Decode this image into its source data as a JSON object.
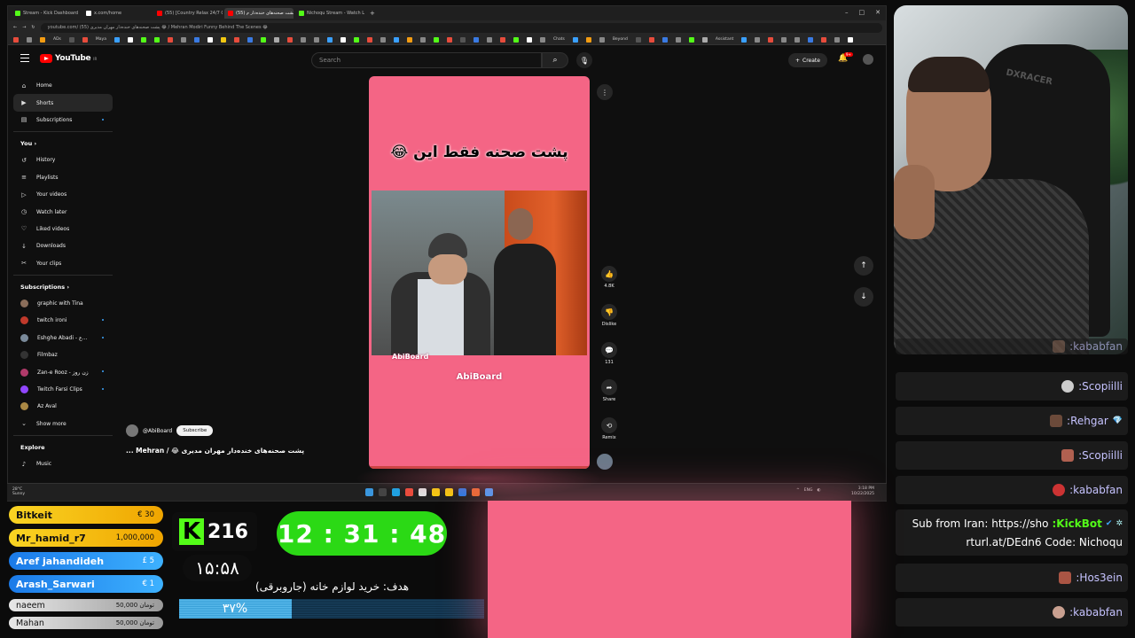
{
  "browser": {
    "tabs": [
      {
        "label": "Stream - Kick Dashboard",
        "color": "#53fc18"
      },
      {
        "label": "x.com/home",
        "color": "#ffffff"
      },
      {
        "label": "(55) [Country Relax 24/7 Co",
        "color": "#ff0000"
      },
      {
        "label": "(55) پشت صحنه‌های خنده‌دار م",
        "color": "#ff0000",
        "active": true
      },
      {
        "label": "Nichoqu Stream - Watch Live",
        "color": "#53fc18"
      }
    ],
    "url": "youtube.com/ (55) پشت صحنه‌های خنده‌دار مهران مدیری 😂 / Mehran Modiri Funny Behind The Scenes 😂",
    "new_tab": "+",
    "window_controls": [
      "–",
      "□",
      "✕"
    ],
    "bookmark_labels": [
      "ADs",
      "Maya",
      "Chats",
      "Beyond",
      "Assistant"
    ]
  },
  "youtube": {
    "logo_text": "YouTube",
    "logo_sup": "IR",
    "search_placeholder": "Search",
    "create_label": "Create",
    "notif_count": "9+",
    "sidebar": {
      "main": [
        {
          "label": "Home",
          "icon": "home-icon",
          "glyph": "⌂"
        },
        {
          "label": "Shorts",
          "icon": "shorts-icon",
          "glyph": "▶",
          "active": true
        },
        {
          "label": "Subscriptions",
          "icon": "subscriptions-icon",
          "glyph": "▤",
          "dot": true
        }
      ],
      "you_header": "You ›",
      "you": [
        {
          "label": "History",
          "icon": "history-icon",
          "glyph": "↺"
        },
        {
          "label": "Playlists",
          "icon": "playlists-icon",
          "glyph": "≡"
        },
        {
          "label": "Your videos",
          "icon": "your-videos-icon",
          "glyph": "▷"
        },
        {
          "label": "Watch later",
          "icon": "watch-later-icon",
          "glyph": "◷"
        },
        {
          "label": "Liked videos",
          "icon": "liked-videos-icon",
          "glyph": "♡"
        },
        {
          "label": "Downloads",
          "icon": "downloads-icon",
          "glyph": "↓"
        },
        {
          "label": "Your clips",
          "icon": "clips-icon",
          "glyph": "✂"
        }
      ],
      "subs_header": "Subscriptions ›",
      "subscriptions": [
        {
          "label": "graphic with Tina",
          "color": "#8a6d5a"
        },
        {
          "label": "twitch ironi",
          "color": "#c0392b",
          "dot": true
        },
        {
          "label": "Eshghe Abadi - ع...",
          "color": "#7a8a9a",
          "dot": true
        },
        {
          "label": "Filmbaz",
          "color": "#333333"
        },
        {
          "label": "Zan-e Rooz - زن روز",
          "color": "#b03a6a",
          "dot": true
        },
        {
          "label": "Twitch Farsi Clips",
          "color": "#9146ff",
          "dot": true
        },
        {
          "label": "Az Aval",
          "color": "#aa8844"
        }
      ],
      "show_more": "Show more",
      "explore_header": "Explore",
      "explore": [
        {
          "label": "Music",
          "icon": "music-icon",
          "glyph": "♪"
        }
      ]
    },
    "short": {
      "title_overlay": "پشت صحنه فقط این 😂",
      "watermark_small": "AbiBoard",
      "watermark_big": "AbiBoard",
      "channel": "@AbiBoard",
      "subscribe": "Subscribe",
      "video_title": "پشت صحنه‌های خنده‌دار مهران مدیری 😂 / Mehran ...",
      "actions": [
        {
          "name": "like",
          "icon": "thumbs-up-icon",
          "glyph": "👍",
          "label": "4.8K"
        },
        {
          "name": "dislike",
          "icon": "thumbs-down-icon",
          "glyph": "👎",
          "label": "Dislike"
        },
        {
          "name": "comments",
          "icon": "comment-icon",
          "glyph": "💬",
          "label": "131"
        },
        {
          "name": "share",
          "icon": "share-icon",
          "glyph": "➦",
          "label": "Share"
        },
        {
          "name": "remix",
          "icon": "remix-icon",
          "glyph": "⟲",
          "label": "Remix"
        }
      ]
    }
  },
  "taskbar": {
    "weather_temp": "28°C",
    "weather_desc": "Sunny",
    "tray_lang": "ENG",
    "time": "3:18 PM",
    "date": "10/22/2025",
    "app_colors": [
      "#3a96dd",
      "#444444",
      "#1fa0e0",
      "#e74c3c",
      "#dddddd",
      "#f2c811",
      "#f2c811",
      "#2a7ae2",
      "#e66b2e",
      "#3aa0ff"
    ]
  },
  "chat": {
    "messages": [
      {
        "name": ":kababfan",
        "avatar_color": "#7a5a4a"
      },
      {
        "name": ":Scopiilli",
        "avatar_color": "#cccccc"
      },
      {
        "name": ":Rehgar",
        "avatar_color": "#6b4a3a",
        "badge": "💎"
      },
      {
        "name": ":Scopiilli",
        "avatar_color": "#b06050"
      },
      {
        "name": ":kababfan",
        "avatar_color": "#cc3333"
      },
      {
        "name": ":Hos3ein",
        "avatar_color": "#aa5544"
      },
      {
        "name": ":kababfan",
        "avatar_color": "#c9a090"
      }
    ],
    "sub": {
      "text_before": "Sub from Iran: https://sho",
      "bot_name": ":KickBot",
      "line2": "rturl.at/DEdn6 Code: Nichoqu"
    }
  },
  "overlay": {
    "donors": [
      {
        "name": "Bitkeit",
        "amount": "€ 30",
        "style": "gold"
      },
      {
        "name": "Mr_hamid_r7",
        "amount": "1,000,000",
        "style": "gold"
      },
      {
        "name": "Aref jahandideh",
        "amount": "£ 5",
        "style": "blue"
      },
      {
        "name": "Arash_Sarwari",
        "amount": "€ 1",
        "style": "blue"
      },
      {
        "name": "naeem",
        "amount": "50,000 تومان",
        "style": "silver"
      },
      {
        "name": "Mahan",
        "amount": "50,000 تومان",
        "style": "silver"
      }
    ],
    "kick_logo": "K",
    "viewer_count": "216",
    "local_clock": "۱۵:۵۸",
    "timer": "12 : 31 : 48",
    "goal_label": "هدف: خرید لوازم خانه (جاروبرقی)",
    "goal_percent_label": "۳۷%",
    "goal_fraction": 0.37
  },
  "colors": {
    "kick_green": "#53fc18",
    "short_pink": "#f46585",
    "chat_name": "#c6c3ff"
  }
}
